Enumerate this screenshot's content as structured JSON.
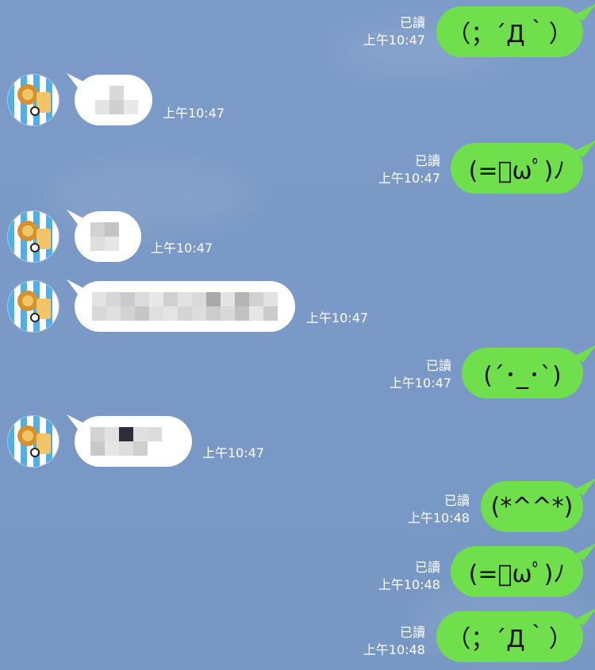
{
  "chat": {
    "messages": [
      {
        "id": 1,
        "side": "out",
        "text": "（；´Д｀）",
        "read": "已讀",
        "time": "上午10:47"
      },
      {
        "id": 2,
        "side": "in",
        "redacted": true,
        "time": "上午10:47"
      },
      {
        "id": 3,
        "side": "out",
        "text": "(=ﾟωﾟ)ﾉ",
        "read": "已讀",
        "time": "上午10:47"
      },
      {
        "id": 4,
        "side": "in",
        "redacted": true,
        "time": "上午10:47"
      },
      {
        "id": 5,
        "side": "in",
        "redacted": true,
        "time": "上午10:47"
      },
      {
        "id": 6,
        "side": "out",
        "text": "(´･_･`)",
        "read": "已讀",
        "time": "上午10:47"
      },
      {
        "id": 7,
        "side": "in",
        "redacted": true,
        "time": "上午10:47"
      },
      {
        "id": 8,
        "side": "out",
        "text": "(*^^*)",
        "read": "已讀",
        "time": "上午10:48"
      },
      {
        "id": 9,
        "side": "out",
        "text": "(=ﾟωﾟ)ﾉ",
        "read": "已讀",
        "time": "上午10:48"
      },
      {
        "id": 10,
        "side": "out",
        "text": "（；´Д｀）",
        "read": "已讀",
        "time": "上午10:48"
      }
    ]
  },
  "colors": {
    "background": "#7c9bc8",
    "outgoing_bubble": "#6fe04c",
    "incoming_bubble": "#ffffff",
    "meta_text": "#ffffff"
  }
}
